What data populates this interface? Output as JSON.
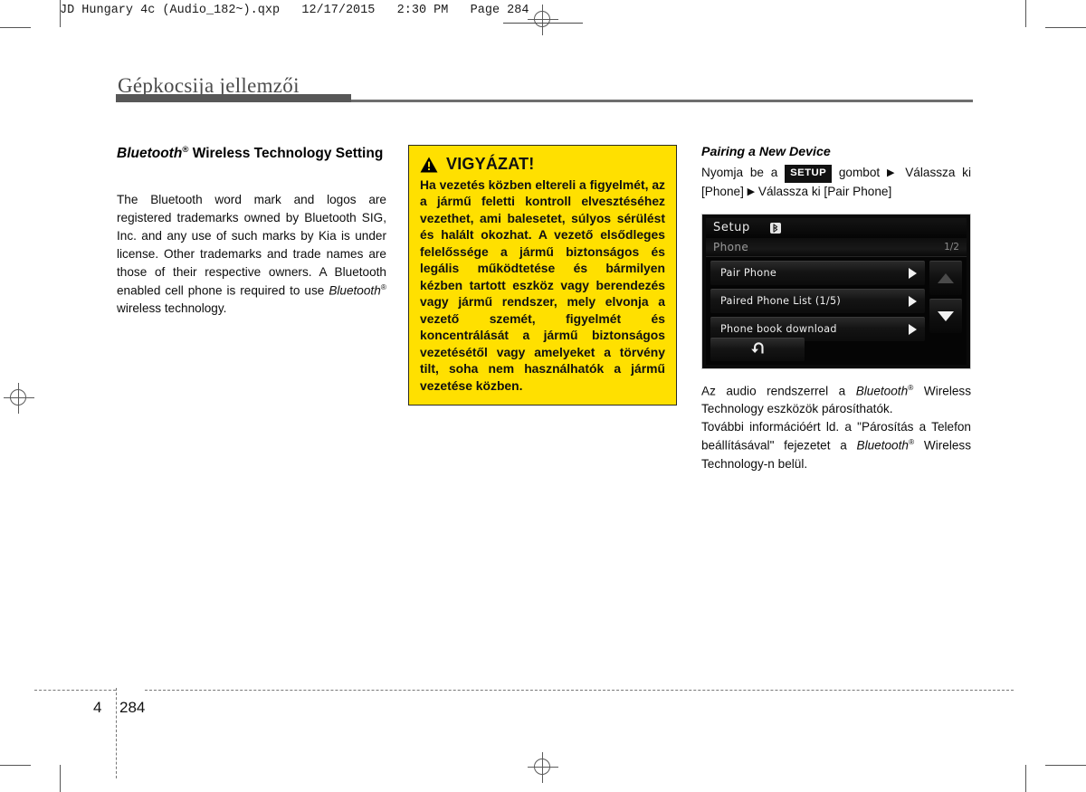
{
  "print_marks": {
    "file_header": "JD Hungary 4c (Audio_182~).qxp   12/17/2015   2:30 PM   Page 284"
  },
  "chapter": {
    "title": "Gépkocsija jellemzői"
  },
  "left_column": {
    "heading_part1": "Bluetooth",
    "heading_sup": "®",
    "heading_part2": " Wireless Technology Setting",
    "paragraph_1": "The Bluetooth word mark and logos are registered trademarks owned by Bluetooth SIG, Inc. and any use of such marks by Kia is under license. Other trademarks and trade names are those of their respective owners. A Bluetooth enabled cell phone is required to use ",
    "paragraph_1_italic": "Bluetooth",
    "paragraph_1_sup": "®",
    "paragraph_1_end": " wireless technology."
  },
  "warning": {
    "icon": "warning-triangle-icon",
    "title": "VIGYÁZAT!",
    "body": "Ha vezetés közben eltereli a figyelmét, az a jármű feletti kontroll elvesztéséhez vezethet, ami balesetet, súlyos sérülést és halált okozhat. A vezető elsődleges felelőssége a jármű biztonságos és legális működtetése és bármilyen kézben tartott eszköz vagy berendezés vagy jármű rendszer, mely elvonja a vezető szemét, figyelmét és koncentrálását a jármű biztonságos vezetésétől vagy amelyeket a törvény tilt, soha nem használhatók a jármű vezetése közben.",
    "background_color": "#FFE000"
  },
  "right_column": {
    "heading": "Pairing a New Device",
    "instruction_1": "Nyomja be a",
    "setup_badge": "SETUP",
    "instruction_2": "gombot",
    "arrow": "▶",
    "instruction_3": "Válassza ki [Phone]",
    "instruction_4": "Válassza ki [Pair Phone]",
    "paragraph_1_a": "Az audio rendszerrel a ",
    "paragraph_1_italic": "Bluetooth",
    "paragraph_1_sup": "®",
    "paragraph_1_b": " Wireless Technology eszközök párosíthatók.",
    "paragraph_2_a": "További információért ld. a \"Párosítás a Telefon beállításával\" fejezetet a ",
    "paragraph_2_italic": "Bluetooth",
    "paragraph_2_sup": "®",
    "paragraph_2_b": " Wireless Technology-n belül."
  },
  "device_screen": {
    "title": "Setup",
    "bluetooth_icon": "bluetooth-icon",
    "sub_label": "Phone",
    "page_indicator": "1/2",
    "rows": [
      {
        "label": "Pair Phone"
      },
      {
        "label": "Paired Phone List  (1/5)"
      },
      {
        "label": "Phone book download"
      }
    ],
    "scroll_up_icon": "triangle-up-icon",
    "scroll_down_icon": "triangle-down-icon",
    "back_icon": "back-arrow-icon"
  },
  "footer": {
    "chapter_number": "4",
    "page_number": "284"
  }
}
